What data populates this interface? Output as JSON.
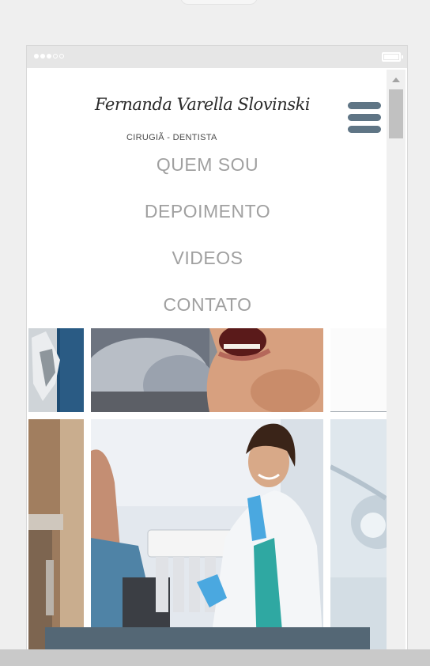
{
  "header": {
    "signature": "Fernanda Varella Slovinski",
    "subtitle": "CIRUGIÃ - DENTISTA"
  },
  "menu": {
    "icon": "hamburger-menu-icon",
    "items": [
      {
        "label": "QUEM SOU"
      },
      {
        "label": "DEPOIMENTO"
      },
      {
        "label": "VIDEOS"
      },
      {
        "label": "CONTATO"
      }
    ]
  },
  "colors": {
    "menu_icon": "#5f7585",
    "nav_text": "#a0a0a0",
    "bottom_bar": "#546775"
  }
}
